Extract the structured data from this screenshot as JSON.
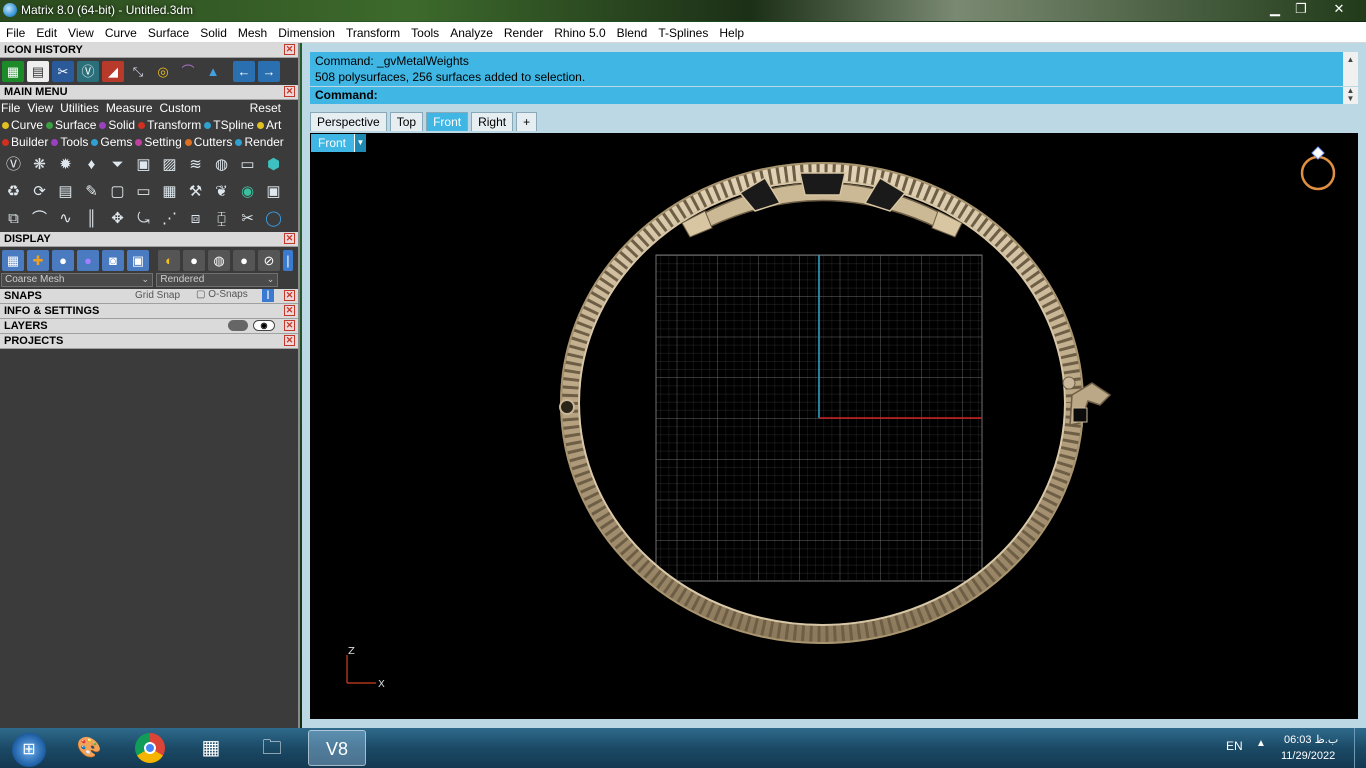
{
  "window": {
    "title": "Matrix 8.0 (64-bit) - Untitled.3dm",
    "controls": [
      "minimize",
      "restore",
      "close"
    ]
  },
  "menubar": [
    "File",
    "Edit",
    "View",
    "Curve",
    "Surface",
    "Solid",
    "Mesh",
    "Dimension",
    "Transform",
    "Tools",
    "Analyze",
    "Render",
    "Rhino 5.0",
    "Blend",
    "T-Splines",
    "Help"
  ],
  "left_panel": {
    "icon_history": {
      "title": "ICON HISTORY"
    },
    "main_menu": {
      "title": "MAIN MENU",
      "menu": [
        "File",
        "View",
        "Utilities",
        "Measure",
        "Custom"
      ],
      "reset": "Reset",
      "categories_row1": [
        "Curve",
        "Surface",
        "Solid",
        "Transform",
        "TSpline",
        "Art"
      ],
      "categories_row2": [
        "Builder",
        "Tools",
        "Gems",
        "Setting",
        "Cutters",
        "Render"
      ]
    },
    "display": {
      "title": "DISPLAY",
      "mesh_select": "Coarse Mesh",
      "render_select": "Rendered"
    },
    "snaps": {
      "title": "SNAPS",
      "grid_snap": "Grid Snap",
      "osnaps": "O-Snaps"
    },
    "info_settings": {
      "title": "INFO & SETTINGS"
    },
    "layers": {
      "title": "LAYERS"
    },
    "projects": {
      "title": "PROJECTS"
    }
  },
  "command": {
    "history_line1": "Command: _gvMetalWeights",
    "history_line2": "508 polysurfaces, 256 surfaces added to selection.",
    "prompt": "Command:"
  },
  "viewport_tabs": [
    "Perspective",
    "Top",
    "Front",
    "Right",
    "+"
  ],
  "active_tab": "Front",
  "viewport": {
    "label": "Front",
    "axis_z": "Z",
    "axis_x": "X"
  },
  "taskbar": {
    "language": "EN",
    "time": "06:03 ب.ظ",
    "date": "11/29/2022",
    "active_app": "V8"
  },
  "colors": {
    "accent": "#3fb6e3",
    "panel_bg": "#3b3b3b",
    "grid": "#5a5a5a",
    "axis_x": "#d02020",
    "axis_z": "#2aa0c8",
    "metal": "#c9b79a"
  }
}
